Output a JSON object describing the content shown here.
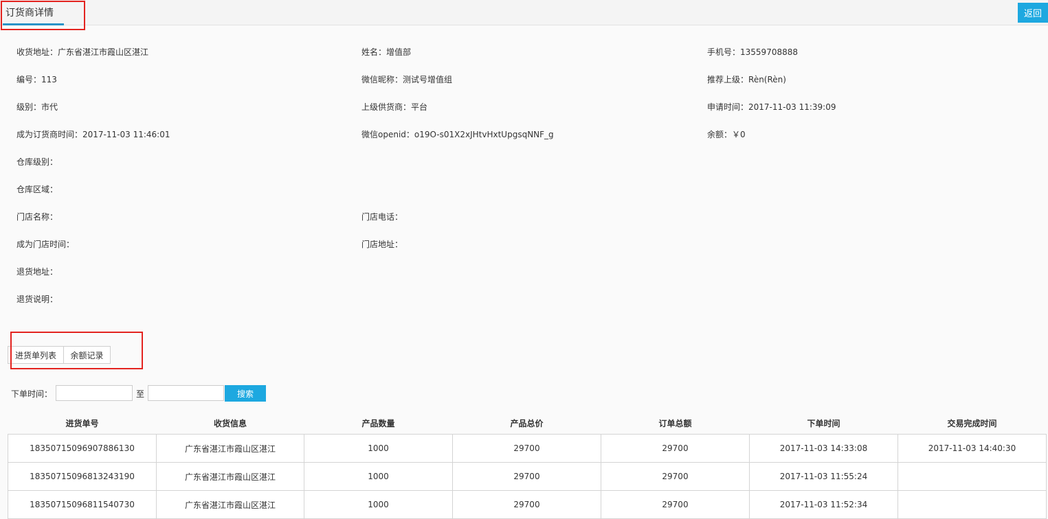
{
  "header": {
    "tab_title": "订货商详情",
    "back_label": "返回"
  },
  "info": {
    "row1": [
      {
        "label": "收货地址：",
        "value": "广东省湛江市霞山区湛江"
      },
      {
        "label": "姓名：",
        "value": "增值部"
      },
      {
        "label": "手机号：",
        "value": "13559708888"
      }
    ],
    "row2": [
      {
        "label": "编号：",
        "value": "113"
      },
      {
        "label": "微信昵称：",
        "value": "测试号增值组"
      },
      {
        "label": "推荐上级：",
        "value": "Rèn(Rèn)"
      }
    ],
    "row3": [
      {
        "label": "级别：",
        "value": "市代"
      },
      {
        "label": "上级供货商：",
        "value": "平台"
      },
      {
        "label": "申请时间：",
        "value": "2017-11-03 11:39:09"
      }
    ],
    "row4": [
      {
        "label": "成为订货商时间：",
        "value": "2017-11-03 11:46:01"
      },
      {
        "label": "微信openid：",
        "value": "o19O-s01X2xJHtvHxtUpgsqNNF_g"
      },
      {
        "label": "余额：",
        "value": "￥0"
      }
    ],
    "warehouse_level": {
      "label": "仓库级别：",
      "value": ""
    },
    "warehouse_area": {
      "label": "仓库区域：",
      "value": ""
    },
    "store_name": {
      "label": "门店名称：",
      "value": ""
    },
    "store_phone": {
      "label": "门店电话：",
      "value": ""
    },
    "store_time": {
      "label": "成为门店时间：",
      "value": ""
    },
    "store_address": {
      "label": "门店地址：",
      "value": ""
    },
    "return_address": {
      "label": "退货地址：",
      "value": ""
    },
    "return_note": {
      "label": "退货说明：",
      "value": ""
    }
  },
  "subtabs": {
    "purchase_list": "进货单列表",
    "balance_records": "余额记录"
  },
  "search": {
    "label": "下单时间：",
    "start_value": "",
    "to_text": "至",
    "end_value": "",
    "button_label": "搜索"
  },
  "table": {
    "headers": [
      "进货单号",
      "收货信息",
      "产品数量",
      "产品总价",
      "订单总额",
      "下单时间",
      "交易完成时间"
    ],
    "rows": [
      [
        "1835071509690788613​0",
        "广东省湛江市霞山区湛江",
        "1000",
        "29700",
        "29700",
        "2017-11-03 14:33:08",
        "2017-11-03 14:40:30"
      ],
      [
        "18350715096813243190",
        "广东省湛江市霞山区湛江",
        "1000",
        "29700",
        "29700",
        "2017-11-03 11:55:24",
        ""
      ],
      [
        "18350715096811540730",
        "广东省湛江市霞山区湛江",
        "1000",
        "29700",
        "29700",
        "2017-11-03 11:52:34",
        ""
      ]
    ]
  },
  "colors": {
    "accent": "#1da8e0",
    "tab_underline": "#2a93c7",
    "highlight": "#e3231f"
  }
}
